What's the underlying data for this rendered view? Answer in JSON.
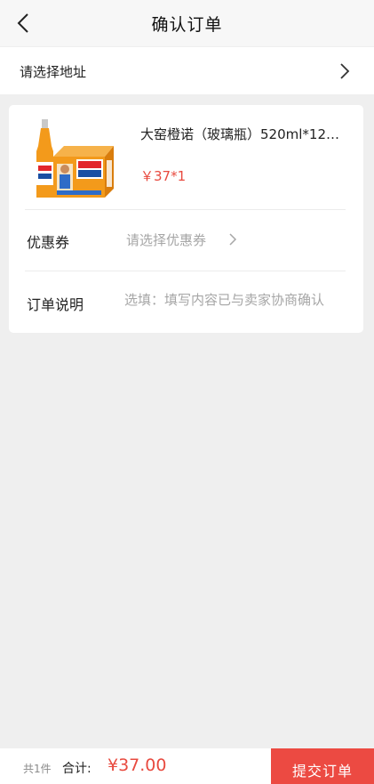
{
  "header": {
    "title": "确认订单",
    "back_icon": "chevron-left-icon"
  },
  "address": {
    "label": "请选择地址",
    "chevron_icon": "chevron-right-icon"
  },
  "order": {
    "product": {
      "title": "大窑橙诺（玻璃瓶）520ml*12…",
      "price": "￥37*1",
      "image": "product-image"
    },
    "coupon": {
      "label": "优惠券",
      "value": "请选择优惠券",
      "chevron_icon": "chevron-right-icon"
    },
    "note": {
      "label": "订单说明",
      "placeholder": "选填：填写内容已与卖家协商确认",
      "value": ""
    }
  },
  "footer": {
    "count": "共1件",
    "total_label": "合计:",
    "total_amount": "¥37.00",
    "submit_label": "提交订单"
  },
  "colors": {
    "accent": "#ec4a42",
    "price": "#e84a3f",
    "background": "#efefef"
  }
}
